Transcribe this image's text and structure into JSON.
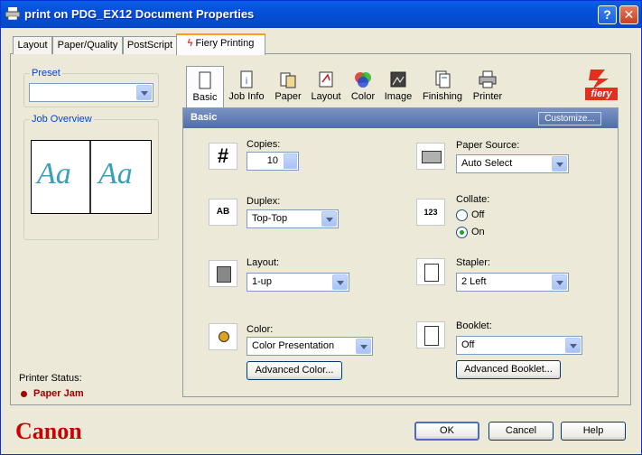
{
  "window": {
    "title": "print on PDG_EX12 Document Properties"
  },
  "tabs": [
    "Layout",
    "Paper/Quality",
    "PostScript",
    "Fiery Printing"
  ],
  "preset": {
    "label": "Preset",
    "value": ""
  },
  "job_overview": {
    "label": "Job Overview",
    "preview_text": "Aa"
  },
  "printer_status": {
    "label": "Printer Status:",
    "value": "Paper Jam",
    "color": "#a00000"
  },
  "icon_tabs": [
    "Basic",
    "Job Info",
    "Paper",
    "Layout",
    "Color",
    "Image",
    "Finishing",
    "Printer"
  ],
  "brand": {
    "fiery": "fiery",
    "canon": "Canon",
    "canon_color": "#cc0000"
  },
  "basic": {
    "header": "Basic",
    "customize_label": "Customize...",
    "copies": {
      "label": "Copies:",
      "value": "10"
    },
    "duplex": {
      "label": "Duplex:",
      "value": "Top-Top"
    },
    "layout": {
      "label": "Layout:",
      "value": "1-up"
    },
    "color": {
      "label": "Color:",
      "value": "Color Presentation",
      "advanced": "Advanced Color..."
    },
    "paper_source": {
      "label": "Paper Source:",
      "value": "Auto Select"
    },
    "collate": {
      "label": "Collate:",
      "off": "Off",
      "on": "On",
      "selected": "On"
    },
    "stapler": {
      "label": "Stapler:",
      "value": "2 Left"
    },
    "booklet": {
      "label": "Booklet:",
      "value": "Off",
      "advanced": "Advanced Booklet..."
    }
  },
  "buttons": {
    "ok": "OK",
    "cancel": "Cancel",
    "help": "Help"
  }
}
